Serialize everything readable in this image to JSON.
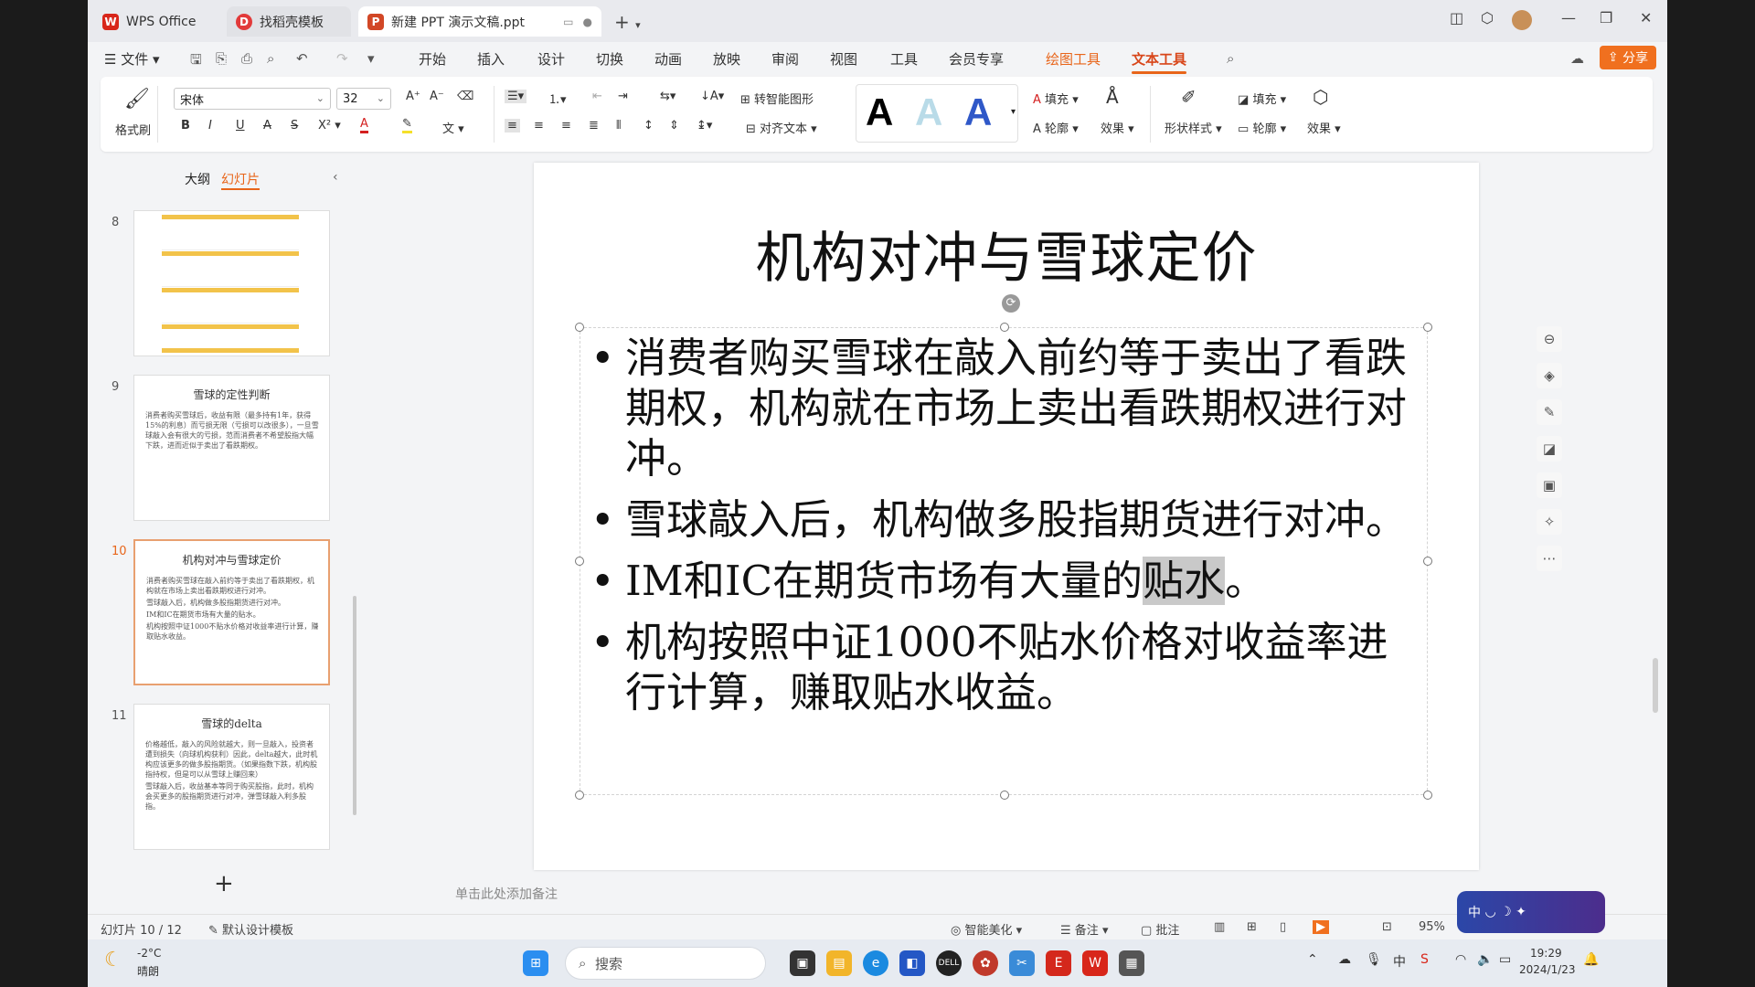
{
  "titlebar": {
    "tabs": [
      {
        "label": "WPS Office",
        "icon": "wps-logo-icon",
        "color": "#d8261a"
      },
      {
        "label": "找稻壳模板",
        "icon": "docer-logo-icon",
        "color": "#e23a3a"
      },
      {
        "label": "新建 PPT 演示文稿.ppt",
        "icon": "ppt-logo-icon",
        "color": "#d24726"
      }
    ],
    "new_tab": "+"
  },
  "menubar": {
    "file_label": "文件",
    "tabs": [
      "开始",
      "插入",
      "设计",
      "切换",
      "动画",
      "放映",
      "审阅",
      "视图",
      "工具",
      "会员专享"
    ],
    "context_tabs": [
      "绘图工具",
      "文本工具"
    ],
    "active_tab": "文本工具",
    "share_label": "分享"
  },
  "ribbon": {
    "format_painter": "格式刷",
    "font_name": "宋体",
    "font_size": "32",
    "smart_shape": "转智能图形",
    "align_text": "对齐文本",
    "fill_label": "填充",
    "outline_label": "轮廓",
    "effect_label": "效果",
    "shape_style_label": "形状样式",
    "shape_fill_label": "填充",
    "shape_outline_label": "轮廓",
    "shape_effect_label": "效果",
    "text_styles": [
      {
        "letter": "A",
        "color": "#000000"
      },
      {
        "letter": "A",
        "color": "#b9dbe8"
      },
      {
        "letter": "A",
        "color": "#2f58c8"
      }
    ]
  },
  "leftpanel": {
    "tabs": [
      "大纲",
      "幻灯片"
    ],
    "active_tab": "幻灯片",
    "slides": [
      {
        "num": "8",
        "title": "",
        "bullets": []
      },
      {
        "num": "9",
        "title": "雪球的定性判断",
        "bullets": [
          "消费者购买雪球后，收益有限（最多持有1年，获得15%的利息）而亏损无限（亏损可以改很多），一旦雪球敲入会有很大的亏损，范而消费者不希望股指大幅下跌，进而近似于卖出了看跌期权。"
        ]
      },
      {
        "num": "10",
        "title": "机构对冲与雪球定价",
        "bullets": [
          "消费者购买雪球在敲入前约等于卖出了看跌期权，机构就在市场上卖出看跌期权进行对冲。",
          "雪球敲入后，机构做多股指期货进行对冲。",
          "IM和IC在期货市场有大量的贴水。",
          "机构按照中证1000不贴水价格对收益率进行计算，赚取贴水收益。"
        ]
      },
      {
        "num": "11",
        "title": "雪球的delta",
        "bullets": [
          "价格越低，敲入的风险就越大，则一旦敲入，投资者遭到损失（向球机构获利）因此，delta越大，此时机构应该更多的做多股指期货。（如果指数下跌，机构股指持权，但是可以从雪球上赚回来）",
          "雪球敲入后，收益基本等同于购买股指，此时，机构会买更多的股指期货进行对冲，弹雪球敲入利多股指。"
        ]
      }
    ],
    "selected_index": 2,
    "add_label": "+"
  },
  "slide": {
    "title": "机构对冲与雪球定价",
    "bullets": [
      {
        "text": "消费者购买雪球在敲入前约等于卖出了看跌期权，机构就在市场上卖出看跌期权进行对冲。"
      },
      {
        "text": "雪球敲入后，机构做多股指期货进行对冲。"
      },
      {
        "pre": "IM和IC在期货市场有大量的",
        "highlight": "贴水",
        "post": "。"
      },
      {
        "text": "机构按照中证1000不贴水价格对收益率进行计算，赚取贴水收益。"
      }
    ]
  },
  "notes_placeholder": "单击此处添加备注",
  "statusbar": {
    "slide_counter": "幻灯片 10 / 12",
    "template": "默认设计模板",
    "beautify": "智能美化",
    "notes": "备注",
    "comments": "批注",
    "zoom": "95%"
  },
  "ime": {
    "label": "中"
  },
  "taskbar": {
    "weather_temp": "-2°C",
    "weather_desc": "晴朗",
    "search_placeholder": "搜索",
    "time": "19:29",
    "date": "2024/1/23"
  }
}
